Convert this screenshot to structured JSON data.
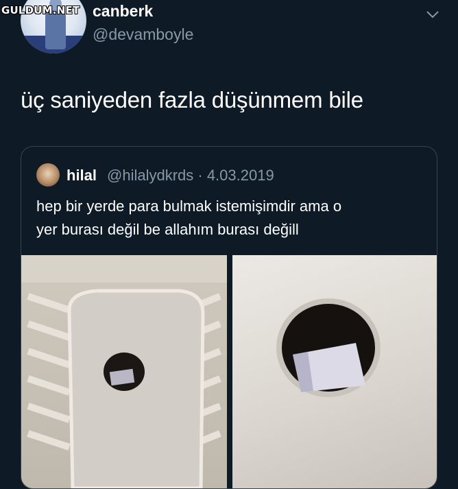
{
  "watermark": "GULDUM.NET",
  "tweet": {
    "display_name": "canberk",
    "username": "@devamboyle",
    "text": "üç saniyeden fazla düşünmem bile"
  },
  "quoted_tweet": {
    "display_name": "hilal",
    "meta": "@hilalydkrds · 4.03.2019",
    "text_line1": "hep bir yerde para bulmak istemişimdir ama o",
    "text_line2": "yer burası değil be allahım burası değill"
  },
  "icons": {
    "menu": "chevron-down-icon"
  },
  "colors": {
    "background": "#0f1a27",
    "secondary_text": "#8899a6",
    "border": "#38444d"
  }
}
